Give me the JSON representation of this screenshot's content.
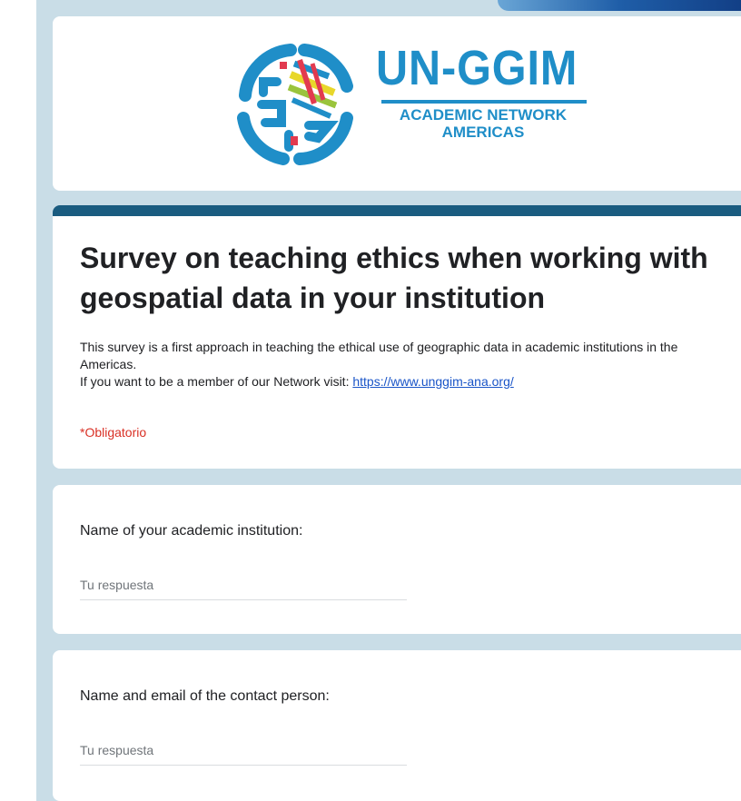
{
  "header": {
    "logo": {
      "name": "UN-GGIM",
      "line1": "ACADEMIC NETWORK",
      "line2": "AMERICAS"
    }
  },
  "form": {
    "title": "Survey on teaching ethics when working with geospatial data in your institution",
    "description_line1": "This survey is a first approach in teaching the ethical use of geographic data in academic institutions  in the Americas.",
    "description_line2_prefix": "If you want to be a member of our Network visit: ",
    "description_link": "https://www.unggim-ana.org/",
    "required_note": "*Obligatorio"
  },
  "questions": [
    {
      "label": "Name of your academic institution:",
      "placeholder": "Tu respuesta"
    },
    {
      "label": "Name and email of the contact person:",
      "placeholder": "Tu respuesta"
    }
  ],
  "colors": {
    "brand_blue": "#1f8ec8",
    "header_bar": "#1a5c80",
    "background": "#c9dde7",
    "required_red": "#d93025",
    "link": "#1a55c8"
  }
}
